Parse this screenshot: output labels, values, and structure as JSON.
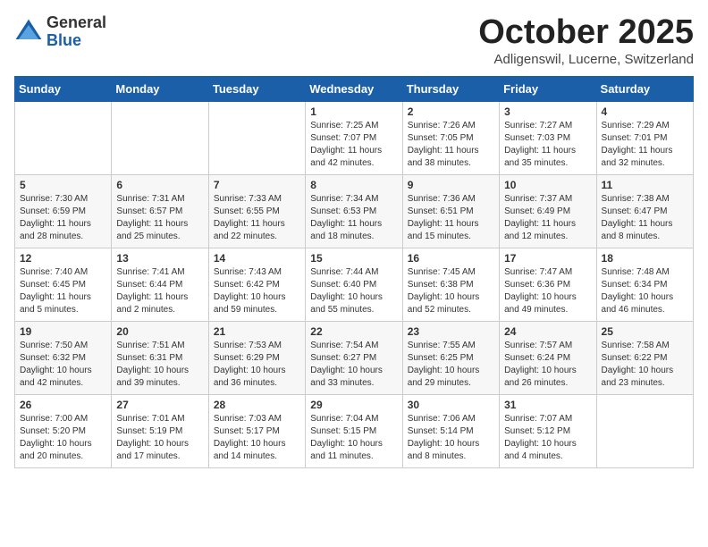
{
  "header": {
    "logo_general": "General",
    "logo_blue": "Blue",
    "month_title": "October 2025",
    "location": "Adligenswil, Lucerne, Switzerland"
  },
  "weekdays": [
    "Sunday",
    "Monday",
    "Tuesday",
    "Wednesday",
    "Thursday",
    "Friday",
    "Saturday"
  ],
  "weeks": [
    [
      {
        "day": "",
        "details": []
      },
      {
        "day": "",
        "details": []
      },
      {
        "day": "",
        "details": []
      },
      {
        "day": "1",
        "details": [
          "Sunrise: 7:25 AM",
          "Sunset: 7:07 PM",
          "Daylight: 11 hours",
          "and 42 minutes."
        ]
      },
      {
        "day": "2",
        "details": [
          "Sunrise: 7:26 AM",
          "Sunset: 7:05 PM",
          "Daylight: 11 hours",
          "and 38 minutes."
        ]
      },
      {
        "day": "3",
        "details": [
          "Sunrise: 7:27 AM",
          "Sunset: 7:03 PM",
          "Daylight: 11 hours",
          "and 35 minutes."
        ]
      },
      {
        "day": "4",
        "details": [
          "Sunrise: 7:29 AM",
          "Sunset: 7:01 PM",
          "Daylight: 11 hours",
          "and 32 minutes."
        ]
      }
    ],
    [
      {
        "day": "5",
        "details": [
          "Sunrise: 7:30 AM",
          "Sunset: 6:59 PM",
          "Daylight: 11 hours",
          "and 28 minutes."
        ]
      },
      {
        "day": "6",
        "details": [
          "Sunrise: 7:31 AM",
          "Sunset: 6:57 PM",
          "Daylight: 11 hours",
          "and 25 minutes."
        ]
      },
      {
        "day": "7",
        "details": [
          "Sunrise: 7:33 AM",
          "Sunset: 6:55 PM",
          "Daylight: 11 hours",
          "and 22 minutes."
        ]
      },
      {
        "day": "8",
        "details": [
          "Sunrise: 7:34 AM",
          "Sunset: 6:53 PM",
          "Daylight: 11 hours",
          "and 18 minutes."
        ]
      },
      {
        "day": "9",
        "details": [
          "Sunrise: 7:36 AM",
          "Sunset: 6:51 PM",
          "Daylight: 11 hours",
          "and 15 minutes."
        ]
      },
      {
        "day": "10",
        "details": [
          "Sunrise: 7:37 AM",
          "Sunset: 6:49 PM",
          "Daylight: 11 hours",
          "and 12 minutes."
        ]
      },
      {
        "day": "11",
        "details": [
          "Sunrise: 7:38 AM",
          "Sunset: 6:47 PM",
          "Daylight: 11 hours",
          "and 8 minutes."
        ]
      }
    ],
    [
      {
        "day": "12",
        "details": [
          "Sunrise: 7:40 AM",
          "Sunset: 6:45 PM",
          "Daylight: 11 hours",
          "and 5 minutes."
        ]
      },
      {
        "day": "13",
        "details": [
          "Sunrise: 7:41 AM",
          "Sunset: 6:44 PM",
          "Daylight: 11 hours",
          "and 2 minutes."
        ]
      },
      {
        "day": "14",
        "details": [
          "Sunrise: 7:43 AM",
          "Sunset: 6:42 PM",
          "Daylight: 10 hours",
          "and 59 minutes."
        ]
      },
      {
        "day": "15",
        "details": [
          "Sunrise: 7:44 AM",
          "Sunset: 6:40 PM",
          "Daylight: 10 hours",
          "and 55 minutes."
        ]
      },
      {
        "day": "16",
        "details": [
          "Sunrise: 7:45 AM",
          "Sunset: 6:38 PM",
          "Daylight: 10 hours",
          "and 52 minutes."
        ]
      },
      {
        "day": "17",
        "details": [
          "Sunrise: 7:47 AM",
          "Sunset: 6:36 PM",
          "Daylight: 10 hours",
          "and 49 minutes."
        ]
      },
      {
        "day": "18",
        "details": [
          "Sunrise: 7:48 AM",
          "Sunset: 6:34 PM",
          "Daylight: 10 hours",
          "and 46 minutes."
        ]
      }
    ],
    [
      {
        "day": "19",
        "details": [
          "Sunrise: 7:50 AM",
          "Sunset: 6:32 PM",
          "Daylight: 10 hours",
          "and 42 minutes."
        ]
      },
      {
        "day": "20",
        "details": [
          "Sunrise: 7:51 AM",
          "Sunset: 6:31 PM",
          "Daylight: 10 hours",
          "and 39 minutes."
        ]
      },
      {
        "day": "21",
        "details": [
          "Sunrise: 7:53 AM",
          "Sunset: 6:29 PM",
          "Daylight: 10 hours",
          "and 36 minutes."
        ]
      },
      {
        "day": "22",
        "details": [
          "Sunrise: 7:54 AM",
          "Sunset: 6:27 PM",
          "Daylight: 10 hours",
          "and 33 minutes."
        ]
      },
      {
        "day": "23",
        "details": [
          "Sunrise: 7:55 AM",
          "Sunset: 6:25 PM",
          "Daylight: 10 hours",
          "and 29 minutes."
        ]
      },
      {
        "day": "24",
        "details": [
          "Sunrise: 7:57 AM",
          "Sunset: 6:24 PM",
          "Daylight: 10 hours",
          "and 26 minutes."
        ]
      },
      {
        "day": "25",
        "details": [
          "Sunrise: 7:58 AM",
          "Sunset: 6:22 PM",
          "Daylight: 10 hours",
          "and 23 minutes."
        ]
      }
    ],
    [
      {
        "day": "26",
        "details": [
          "Sunrise: 7:00 AM",
          "Sunset: 5:20 PM",
          "Daylight: 10 hours",
          "and 20 minutes."
        ]
      },
      {
        "day": "27",
        "details": [
          "Sunrise: 7:01 AM",
          "Sunset: 5:19 PM",
          "Daylight: 10 hours",
          "and 17 minutes."
        ]
      },
      {
        "day": "28",
        "details": [
          "Sunrise: 7:03 AM",
          "Sunset: 5:17 PM",
          "Daylight: 10 hours",
          "and 14 minutes."
        ]
      },
      {
        "day": "29",
        "details": [
          "Sunrise: 7:04 AM",
          "Sunset: 5:15 PM",
          "Daylight: 10 hours",
          "and 11 minutes."
        ]
      },
      {
        "day": "30",
        "details": [
          "Sunrise: 7:06 AM",
          "Sunset: 5:14 PM",
          "Daylight: 10 hours",
          "and 8 minutes."
        ]
      },
      {
        "day": "31",
        "details": [
          "Sunrise: 7:07 AM",
          "Sunset: 5:12 PM",
          "Daylight: 10 hours",
          "and 4 minutes."
        ]
      },
      {
        "day": "",
        "details": []
      }
    ]
  ]
}
